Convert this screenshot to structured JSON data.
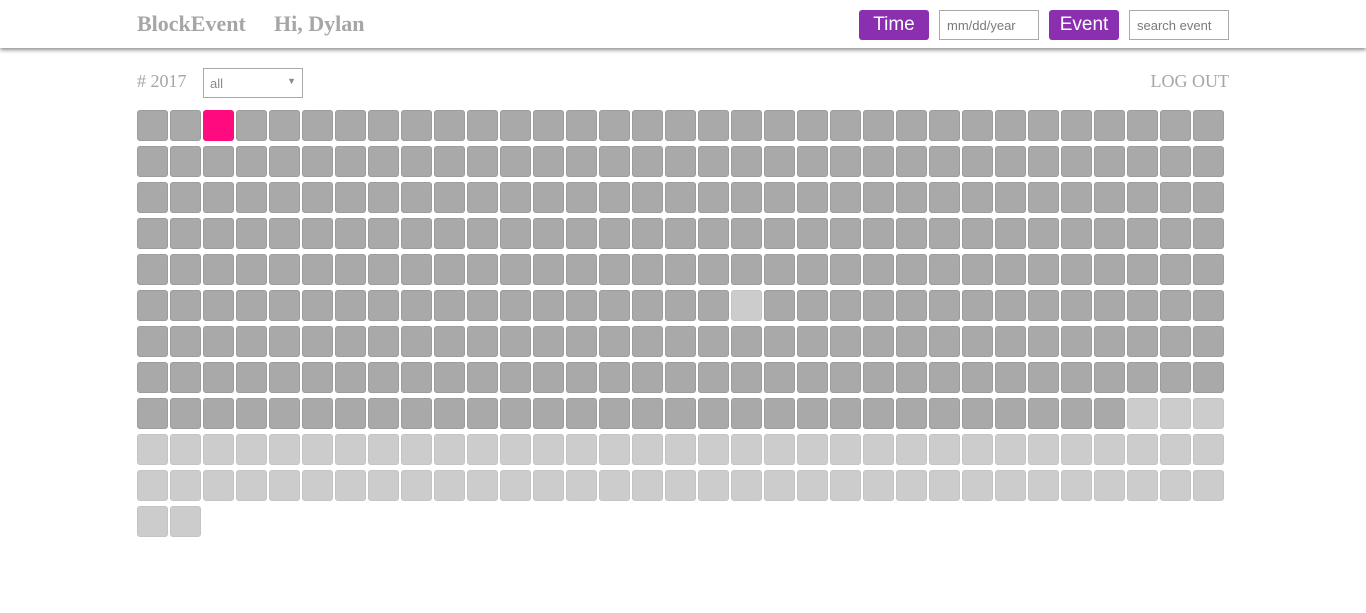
{
  "header": {
    "brand": "BlockEvent",
    "greeting": "Hi, Dylan",
    "time_button_label": "Time",
    "date_placeholder": "mm/dd/year",
    "event_button_label": "Event",
    "search_placeholder": "search event"
  },
  "toolbar": {
    "year_label": "# 2017",
    "filter_value": "all",
    "logout_label": "LOG OUT"
  },
  "calendar": {
    "total_days": 365,
    "columns": 33,
    "past_days": 294,
    "highlighted_day": 3,
    "also_light_day": 184
  },
  "colors": {
    "accent": "#8a2fb0",
    "past_cell": "#a9a9a9",
    "future_cell": "#cccccc",
    "highlight_cell": "#ff0a7f",
    "muted_text": "#a6a6a6"
  }
}
